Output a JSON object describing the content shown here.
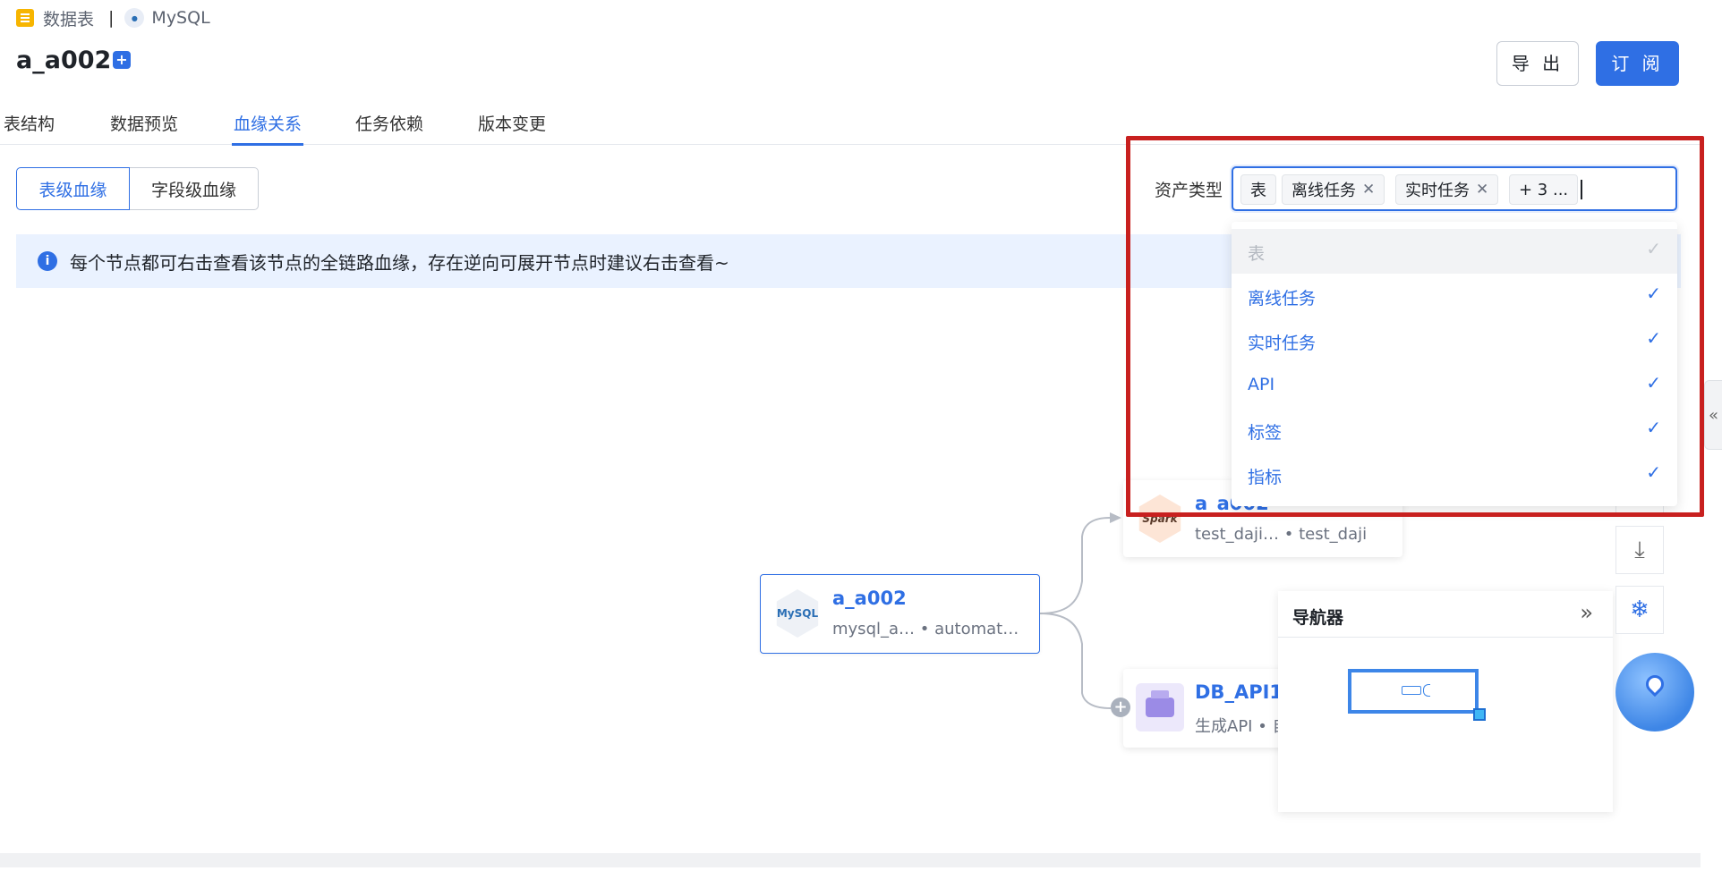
{
  "breadcrumb": {
    "type_label": "数据表",
    "separator": "|",
    "source_label": "MySQL"
  },
  "page": {
    "title": "a_a002"
  },
  "header": {
    "export_label": "导 出",
    "subscribe_label": "订 阅"
  },
  "tabs": [
    {
      "label": "表结构"
    },
    {
      "label": "数据预览"
    },
    {
      "label": "血缘关系"
    },
    {
      "label": "任务依赖"
    },
    {
      "label": "版本变更"
    }
  ],
  "active_tab": "血缘关系",
  "lineage_mode": {
    "table_label": "表级血缘",
    "field_label": "字段级血缘"
  },
  "info": {
    "text": "每个节点都可右击查看该节点的全链路血缘，存在逆向可展开节点时建议右击查看~"
  },
  "filter": {
    "label": "资产类型",
    "tags": [
      {
        "label": "表",
        "closable": false
      },
      {
        "label": "离线任务",
        "closable": true
      },
      {
        "label": "实时任务",
        "closable": true
      }
    ],
    "more_label": "+ 3 ...",
    "options": [
      {
        "label": "表",
        "state": "disabled"
      },
      {
        "label": "离线任务",
        "state": "selected"
      },
      {
        "label": "实时任务",
        "state": "selected"
      },
      {
        "label": "API",
        "state": "selected"
      },
      {
        "label": "标签",
        "state": "selected"
      },
      {
        "label": "指标",
        "state": "selected"
      }
    ],
    "check_icon": "check-icon"
  },
  "nodes": {
    "main": {
      "title": "a_a002",
      "subtitle": "mysql_a… • automat…",
      "icon": "mysql-hex-icon",
      "icon_text": "MySQL"
    },
    "spark": {
      "title": "a_a002",
      "subtitle": "test_daji… • test_daji",
      "icon": "spark-hex-icon",
      "icon_text": "Spark"
    },
    "api": {
      "title": "DB_API1",
      "subtitle": "生成API • 自",
      "icon": "api-printer-icon"
    }
  },
  "navigator": {
    "title": "导航器"
  },
  "colors": {
    "primary": "#2f6fe4",
    "highlight": "#c8201f",
    "info_bg": "#eaf2ff"
  }
}
